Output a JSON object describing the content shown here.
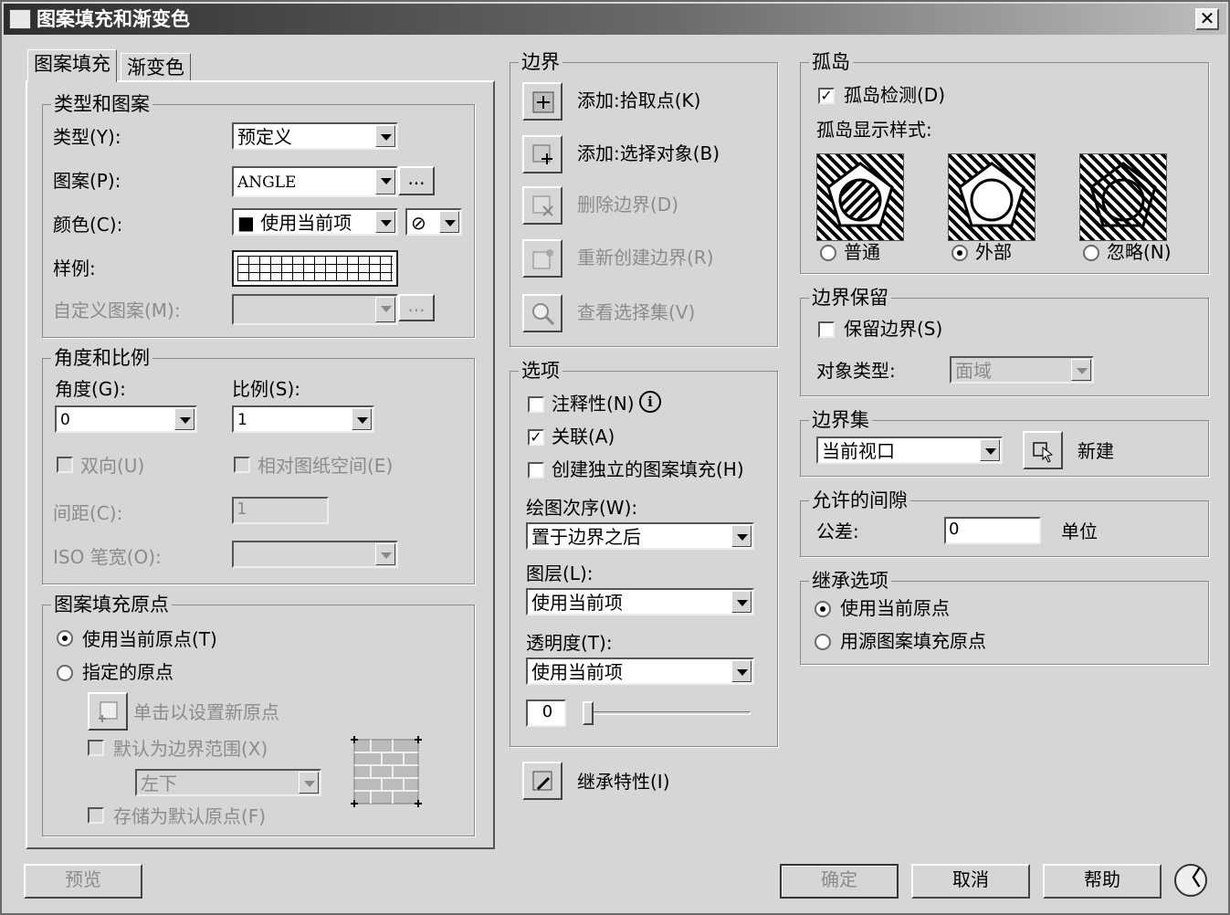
{
  "window": {
    "title": "图案填充和渐变色",
    "close": "✕"
  },
  "tabs": [
    "图案填充",
    "渐变色"
  ],
  "type_pattern": {
    "legend": "类型和图案",
    "type_label": "类型(Y):",
    "type_value": "预定义",
    "pattern_label": "图案(P):",
    "pattern_value": "ANGLE",
    "browse": "...",
    "color_label": "颜色(C):",
    "color_value": "■ 使用当前项",
    "bgcolor_value": "⊘",
    "sample_label": "样例:",
    "custom_label": "自定义图案(M):",
    "custom_browse": "..."
  },
  "angle_scale": {
    "legend": "角度和比例",
    "angle_label": "角度(G):",
    "angle_value": "0",
    "scale_label": "比例(S):",
    "scale_value": "1",
    "double_label": "双向(U)",
    "relative_label": "相对图纸空间(E)",
    "spacing_label": "间距(C):",
    "spacing_value": "1",
    "iso_label": "ISO 笔宽(O):"
  },
  "origin": {
    "legend": "图案填充原点",
    "use_current": "使用当前原点(T)",
    "specified": "指定的原点",
    "click_set": "单击以设置新原点",
    "default_extent": "默认为边界范围(X)",
    "position_value": "左下",
    "store_default": "存储为默认原点(F)"
  },
  "boundaries": {
    "legend": "边界",
    "add_pick": "添加:拾取点(K)",
    "add_select": "添加:选择对象(B)",
    "remove": "删除边界(D)",
    "recreate": "重新创建边界(R)",
    "view": "查看选择集(V)"
  },
  "options": {
    "legend": "选项",
    "annotative": "注释性(N)",
    "associative": "关联(A)",
    "separate": "创建独立的图案填充(H)",
    "draw_order_label": "绘图次序(W):",
    "draw_order_value": "置于边界之后",
    "layer_label": "图层(L):",
    "layer_value": "使用当前项",
    "transparency_label": "透明度(T):",
    "transparency_value": "使用当前项",
    "transparency_number": "0"
  },
  "inherit_props": "继承特性(I)",
  "islands": {
    "legend": "孤岛",
    "detect": "孤岛检测(D)",
    "style_label": "孤岛显示样式:",
    "normal": "普通",
    "outer": "外部",
    "ignore": "忽略(N)"
  },
  "retention": {
    "legend": "边界保留",
    "retain": "保留边界(S)",
    "object_type_label": "对象类型:",
    "object_type_value": "面域"
  },
  "boundary_set": {
    "legend": "边界集",
    "value": "当前视口",
    "new": "新建"
  },
  "gap": {
    "legend": "允许的间隙",
    "tolerance_label": "公差:",
    "tolerance_value": "0",
    "unit": "单位"
  },
  "inherit_options": {
    "legend": "继承选项",
    "use_current": "使用当前原点",
    "use_source": "用源图案填充原点"
  },
  "footer": {
    "preview": "预览",
    "ok": "确定",
    "cancel": "取消",
    "help": "帮助",
    "more": "〈"
  }
}
